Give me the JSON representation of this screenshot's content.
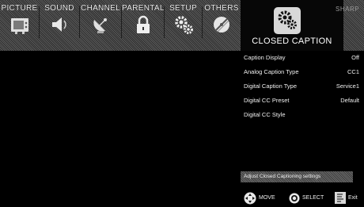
{
  "tabs": [
    {
      "label": "PICTURE",
      "icon": "tv-icon"
    },
    {
      "label": "SOUND",
      "icon": "speaker-icon"
    },
    {
      "label": "CHANNEL",
      "icon": "satellite-dish-icon"
    },
    {
      "label": "PARENTAL",
      "icon": "padlock-icon"
    },
    {
      "label": "SETUP",
      "icon": "gears-icon"
    },
    {
      "label": "OTHERS",
      "icon": "disc-icon"
    }
  ],
  "header": {
    "title": "CLOSED CAPTION",
    "icon": "gears-icon",
    "brand": "SHARP"
  },
  "menu": [
    {
      "label": "Caption Display",
      "value": "Off"
    },
    {
      "label": "Analog Caption Type",
      "value": "CC1"
    },
    {
      "label": "Digital Caption Type",
      "value": "Service1"
    },
    {
      "label": "Digital CC Preset",
      "value": "Default"
    },
    {
      "label": "Digital CC Style",
      "value": ""
    }
  ],
  "help_text": "Adjust Closed Captioning settings",
  "legend": {
    "move": "MOVE",
    "select": "SELECT",
    "exit": "Exit"
  }
}
